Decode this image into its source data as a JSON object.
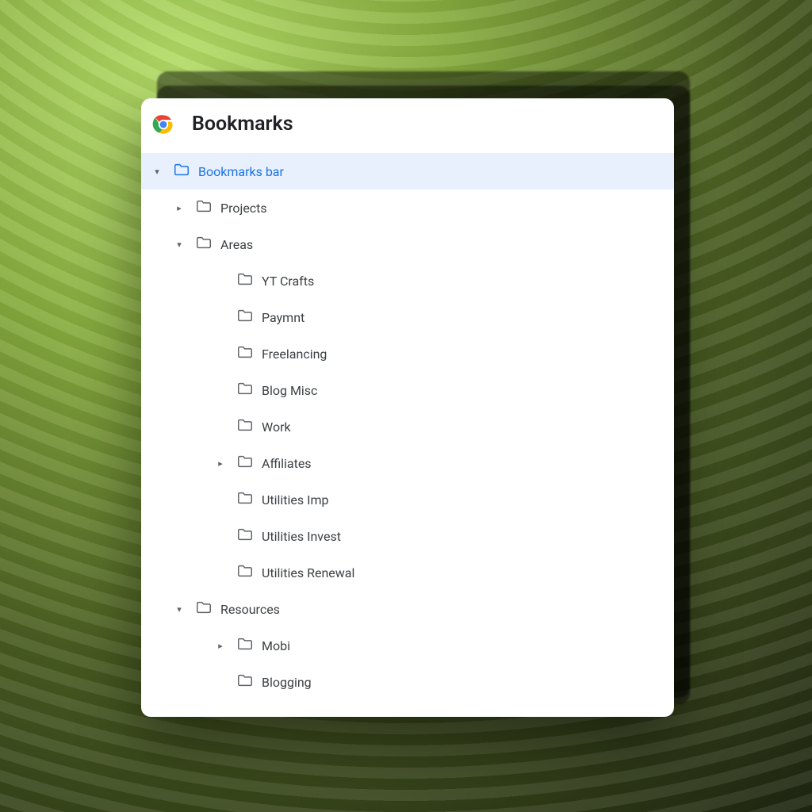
{
  "header": {
    "title": "Bookmarks"
  },
  "tree": {
    "items": [
      {
        "label": "Bookmarks bar",
        "level": 0,
        "arrow": "down",
        "selected": true
      },
      {
        "label": "Projects",
        "level": 1,
        "arrow": "right",
        "selected": false
      },
      {
        "label": "Areas",
        "level": 1,
        "arrow": "down",
        "selected": false
      },
      {
        "label": "YT Crafts",
        "level": 2,
        "arrow": "",
        "selected": false
      },
      {
        "label": "Paymnt",
        "level": 2,
        "arrow": "",
        "selected": false
      },
      {
        "label": "Freelancing",
        "level": 2,
        "arrow": "",
        "selected": false
      },
      {
        "label": "Blog Misc",
        "level": 2,
        "arrow": "",
        "selected": false
      },
      {
        "label": "Work",
        "level": 2,
        "arrow": "",
        "selected": false
      },
      {
        "label": "Affiliates",
        "level": 2,
        "arrow": "right",
        "selected": false
      },
      {
        "label": "Utilities Imp",
        "level": 2,
        "arrow": "",
        "selected": false
      },
      {
        "label": "Utilities Invest",
        "level": 2,
        "arrow": "",
        "selected": false
      },
      {
        "label": "Utilities Renewal",
        "level": 2,
        "arrow": "",
        "selected": false
      },
      {
        "label": "Resources",
        "level": 1,
        "arrow": "down",
        "selected": false
      },
      {
        "label": "Mobi",
        "level": 2,
        "arrow": "right",
        "selected": false
      },
      {
        "label": "Blogging",
        "level": 2,
        "arrow": "",
        "selected": false
      }
    ]
  }
}
